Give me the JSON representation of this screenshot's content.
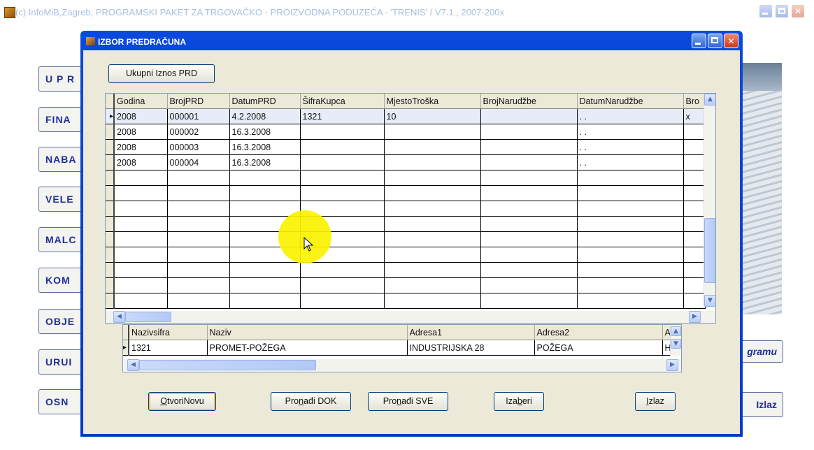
{
  "outer_window": {
    "title": "(c) InfoMiB,Zagreb, PROGRAMSKI PAKET ZA TRGOVAČKO - PROIZVODNA PODUZEĆA - 'TRENIS' / V7.1., 2007-200x"
  },
  "background_menu": {
    "left_buttons": [
      "U P R",
      "FINA",
      "NABA",
      "VELE",
      "MALC",
      "KOM",
      "OBJE",
      "URUI",
      "OSN"
    ],
    "right_buttons": [
      "gramu",
      "Izlaz"
    ]
  },
  "dialog": {
    "title": "IZBOR PREDRAČUNA",
    "total_button": "Ukupni Iznos PRD",
    "main_grid": {
      "columns": [
        "Godina",
        "BrojPRD",
        "DatumPRD",
        "ŠifraKupca",
        "MjestoTroška",
        "BrojNarudžbe",
        "DatumNarudžbe",
        "Bro"
      ],
      "rows": [
        [
          "2008",
          "000001",
          "4.2.2008",
          "1321",
          "10",
          "",
          ". .",
          "x"
        ],
        [
          "2008",
          "000002",
          "16.3.2008",
          "",
          "",
          "",
          ". .",
          ""
        ],
        [
          "2008",
          "000003",
          "16.3.2008",
          "",
          "",
          "",
          ". .",
          ""
        ],
        [
          "2008",
          "000004",
          "16.3.2008",
          "",
          "",
          "",
          ". .",
          ""
        ]
      ],
      "empty_rows": 9
    },
    "customer_grid": {
      "columns": [
        "Nazivsifra",
        "Naziv",
        "Adresa1",
        "Adresa2",
        "A"
      ],
      "rows": [
        [
          "1321",
          "PROMET-POŽEGA",
          "INDUSTRIJSKA 28",
          " POŽEGA",
          "H"
        ]
      ]
    },
    "buttons": {
      "open_new": {
        "pre": "",
        "u": "O",
        "post": "tvoriNovu"
      },
      "find_doc": {
        "pre": "Pro",
        "u": "n",
        "post": "ađi DOK"
      },
      "find_all": {
        "pre": "Pro",
        "u": "n",
        "post": "ađi SVE"
      },
      "select": {
        "pre": "Iza",
        "u": "b",
        "post": "eri"
      },
      "exit": {
        "pre": "",
        "u": "I",
        "post": "zlaz"
      }
    }
  },
  "colors": {
    "title_bar": "#0a49dc",
    "client_bg": "#ece9d8",
    "highlight": "#fbf200",
    "menu_text": "#1f2f9a"
  }
}
